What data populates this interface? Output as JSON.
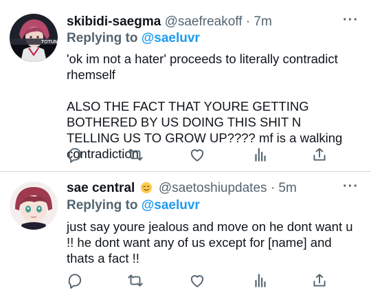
{
  "tweets": [
    {
      "name": "skibidi-saegma",
      "handle": "@saefreakoff",
      "separator": "·",
      "time": "7m",
      "reply_prefix": "Replying to",
      "reply_user": "@saeluvr",
      "avatar_text": "TOTUN",
      "paragraphs": [
        "'ok im not a hater' proceeds to literally contradict rhemself",
        "ALSO THE FACT THAT YOURE GETTING BOTHERED BY US DOING THIS SHIT N TELLING US TO GROW UP???? mf is a walking contradiction"
      ],
      "icons": [
        "reply-icon",
        "retweet-icon",
        "like-icon",
        "stats-icon",
        "share-icon"
      ]
    },
    {
      "name": "sae central",
      "name_emoji": "relieved-face-emoji",
      "handle": "@saetoshiupdates",
      "separator": "·",
      "time": "5m",
      "reply_prefix": "Replying to",
      "reply_user": "@saeluvr",
      "paragraphs": [
        "just say youre jealous and move on he dont want u !! he dont want any of us except for [name] and thats a fact !!"
      ],
      "icons": [
        "reply-icon",
        "retweet-icon",
        "like-icon",
        "stats-icon",
        "share-icon"
      ]
    }
  ],
  "colors": {
    "link": "#1d9bf0",
    "secondary": "#536471",
    "text": "#0f1419",
    "divider": "#cfd9de"
  }
}
